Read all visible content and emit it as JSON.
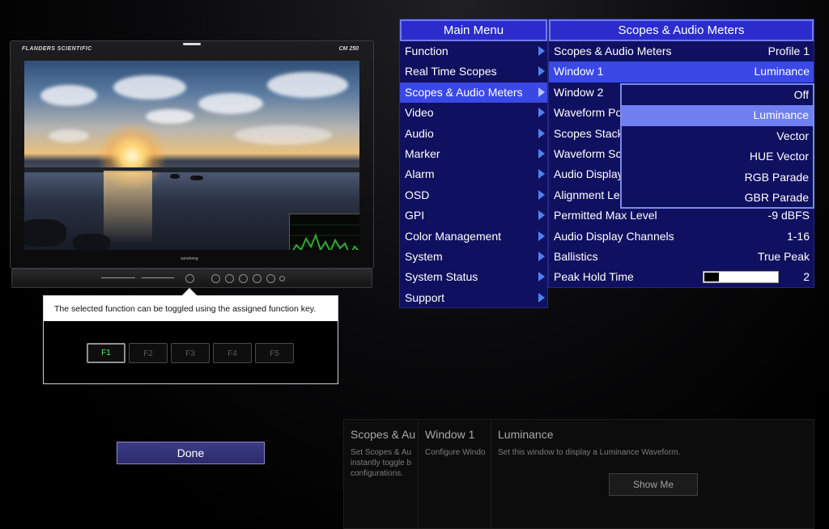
{
  "monitor": {
    "brand": "FLANDERS SCIENTIFIC",
    "model": "CM 250",
    "lower_label": "sunsheng"
  },
  "tooltip": {
    "text": "The selected function can be toggled using the assigned function key.",
    "fkeys": [
      "F1",
      "F2",
      "F3",
      "F4",
      "F5"
    ],
    "active_key": "F1"
  },
  "done_label": "Done",
  "main_menu": {
    "title": "Main Menu",
    "items": [
      "Function",
      "Real Time Scopes",
      "Scopes & Audio Meters",
      "Video",
      "Audio",
      "Marker",
      "Alarm",
      "OSD",
      "GPI",
      "Color Management",
      "System",
      "System Status",
      "Support"
    ],
    "selected": "Scopes & Audio Meters"
  },
  "sub_menu": {
    "title": "Scopes & Audio Meters",
    "rows": [
      {
        "label": "Scopes & Audio Meters",
        "value": "Profile 1"
      },
      {
        "label": "Window 1",
        "value": "Luminance"
      },
      {
        "label": "Window 2",
        "value": ""
      },
      {
        "label": "Waveform Po",
        "value": ""
      },
      {
        "label": "Scopes Stack",
        "value": ""
      },
      {
        "label": "Waveform Sc",
        "value": ""
      },
      {
        "label": "Audio Display",
        "value": ""
      },
      {
        "label": "Alignment Le",
        "value": ""
      },
      {
        "label": "Permitted Max Level",
        "value": "-9 dBFS"
      },
      {
        "label": "Audio Display Channels",
        "value": "1-16"
      },
      {
        "label": "Ballistics",
        "value": "True Peak"
      },
      {
        "label": "Peak Hold Time",
        "value": "2"
      }
    ],
    "selected": "Window 1",
    "peak_hold_level": 0.2
  },
  "dropdown": {
    "options": [
      "Off",
      "Luminance",
      "Vector",
      "HUE Vector",
      "RGB Parade",
      "GBR Parade"
    ],
    "selected": "Luminance"
  },
  "help_panels": {
    "panel1": {
      "title": "Scopes & Au",
      "desc": [
        "Set Scopes & Au",
        "instantly toggle b",
        "configurations."
      ]
    },
    "panel2": {
      "title": "Window 1",
      "desc": [
        "Configure Windo"
      ]
    },
    "panel3": {
      "title": "Luminance",
      "desc": [
        "Set this window to display a Luminance Waveform."
      ],
      "button": "Show Me"
    }
  },
  "colors": {
    "menu_bg": "#101060",
    "menu_title": "#2c2ccc",
    "menu_selected": "#3a48e6",
    "dropdown_selected": "#6f7ff0",
    "arrow": "#4e82f0",
    "active_key": "#63f05a"
  }
}
